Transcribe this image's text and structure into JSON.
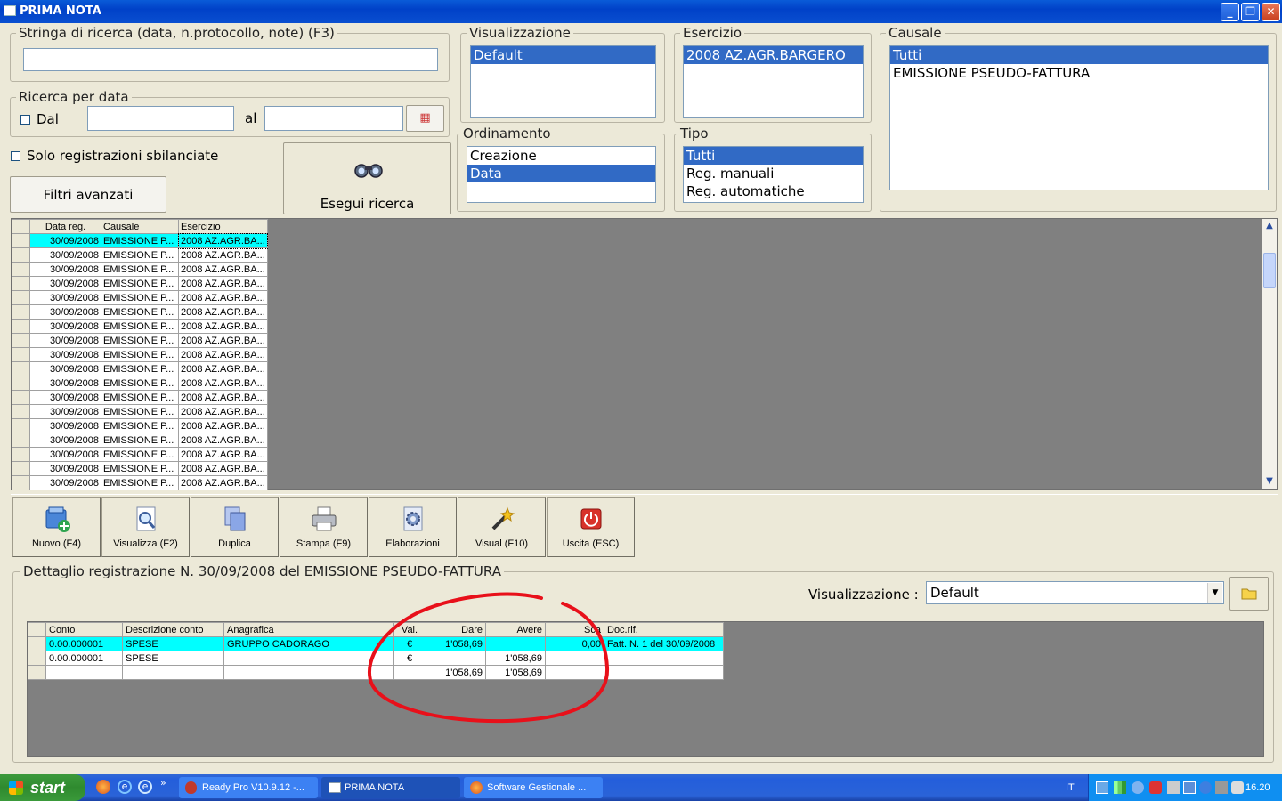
{
  "window": {
    "title": "PRIMA NOTA"
  },
  "search": {
    "label": "Stringa di ricerca (data, n.protocollo, note) (F3)",
    "value": ""
  },
  "date_search": {
    "label": "Ricerca per data",
    "from_label": "Dal",
    "to_label": "al",
    "from_value": "",
    "to_value": ""
  },
  "unbalanced_label": "Solo registrazioni sbilanciate",
  "advanced_filters_label": "Filtri avanzati",
  "run_search_label": "Esegui ricerca",
  "view": {
    "label": "Visualizzazione",
    "items": [
      "Default"
    ],
    "selected": 0
  },
  "order": {
    "label": "Ordinamento",
    "items": [
      "Creazione",
      "Data"
    ],
    "selected": 1
  },
  "fiscal_year": {
    "label": "Esercizio",
    "items": [
      "2008 AZ.AGR.BARGERO"
    ],
    "selected": 0
  },
  "type": {
    "label": "Tipo",
    "items": [
      "Tutti",
      "Reg. manuali",
      "Reg. automatiche"
    ],
    "selected": 0
  },
  "causale": {
    "label": "Causale",
    "items": [
      "Tutti",
      "EMISSIONE PSEUDO-FATTURA"
    ],
    "selected": 0
  },
  "grid": {
    "columns": [
      "Data reg.",
      "Causale",
      "Esercizio"
    ],
    "rows": [
      [
        "30/09/2008",
        "EMISSIONE P...",
        "2008 AZ.AGR.BA..."
      ],
      [
        "30/09/2008",
        "EMISSIONE P...",
        "2008 AZ.AGR.BA..."
      ],
      [
        "30/09/2008",
        "EMISSIONE P...",
        "2008 AZ.AGR.BA..."
      ],
      [
        "30/09/2008",
        "EMISSIONE P...",
        "2008 AZ.AGR.BA..."
      ],
      [
        "30/09/2008",
        "EMISSIONE P...",
        "2008 AZ.AGR.BA..."
      ],
      [
        "30/09/2008",
        "EMISSIONE P...",
        "2008 AZ.AGR.BA..."
      ],
      [
        "30/09/2008",
        "EMISSIONE P...",
        "2008 AZ.AGR.BA..."
      ],
      [
        "30/09/2008",
        "EMISSIONE P...",
        "2008 AZ.AGR.BA..."
      ],
      [
        "30/09/2008",
        "EMISSIONE P...",
        "2008 AZ.AGR.BA..."
      ],
      [
        "30/09/2008",
        "EMISSIONE P...",
        "2008 AZ.AGR.BA..."
      ],
      [
        "30/09/2008",
        "EMISSIONE P...",
        "2008 AZ.AGR.BA..."
      ],
      [
        "30/09/2008",
        "EMISSIONE P...",
        "2008 AZ.AGR.BA..."
      ],
      [
        "30/09/2008",
        "EMISSIONE P...",
        "2008 AZ.AGR.BA..."
      ],
      [
        "30/09/2008",
        "EMISSIONE P...",
        "2008 AZ.AGR.BA..."
      ],
      [
        "30/09/2008",
        "EMISSIONE P...",
        "2008 AZ.AGR.BA..."
      ],
      [
        "30/09/2008",
        "EMISSIONE P...",
        "2008 AZ.AGR.BA..."
      ],
      [
        "30/09/2008",
        "EMISSIONE P...",
        "2008 AZ.AGR.BA..."
      ],
      [
        "30/09/2008",
        "EMISSIONE P...",
        "2008 AZ.AGR.BA..."
      ]
    ]
  },
  "toolbar": [
    {
      "label": "Nuovo (F4)",
      "icon": "new-document-icon"
    },
    {
      "label": "Visualizza (F2)",
      "icon": "magnifier-icon"
    },
    {
      "label": "Duplica",
      "icon": "duplicate-icon"
    },
    {
      "label": "Stampa (F9)",
      "icon": "printer-icon"
    },
    {
      "label": "Elaborazioni",
      "icon": "gear-document-icon"
    },
    {
      "label": "Visual (F10)",
      "icon": "magic-wand-icon"
    },
    {
      "label": "Uscita (ESC)",
      "icon": "power-icon"
    }
  ],
  "detail": {
    "title": "Dettaglio registrazione N. 30/09/2008 del EMISSIONE PSEUDO-FATTURA",
    "view_label": "Visualizzazione :",
    "view_value": "Default",
    "columns": [
      "Conto",
      "Descrizione conto",
      "Anagrafica",
      "Val.",
      "Dare",
      "Avere",
      "Sca",
      "Doc.rif."
    ],
    "rows": [
      [
        "0.00.000001",
        "SPESE",
        "GRUPPO CADORAGO",
        "€",
        "1'058,69",
        "",
        "0,00",
        "Fatt. N. 1 del 30/09/2008"
      ],
      [
        "0.00.000001",
        "SPESE",
        "",
        "€",
        "",
        "1'058,69",
        "",
        ""
      ],
      [
        "",
        "",
        "",
        "",
        "1'058,69",
        "1'058,69",
        "",
        ""
      ]
    ]
  },
  "taskbar": {
    "start_label": "start",
    "tasks": [
      "Ready Pro V10.9.12 -...",
      "PRIMA NOTA",
      "Software Gestionale ..."
    ],
    "language": "IT",
    "clock": "16.20"
  },
  "colors": {
    "selection": "#316ac5",
    "current_row": "#00ffff",
    "annotation": "#e8101a",
    "grid_bg": "#808080"
  }
}
